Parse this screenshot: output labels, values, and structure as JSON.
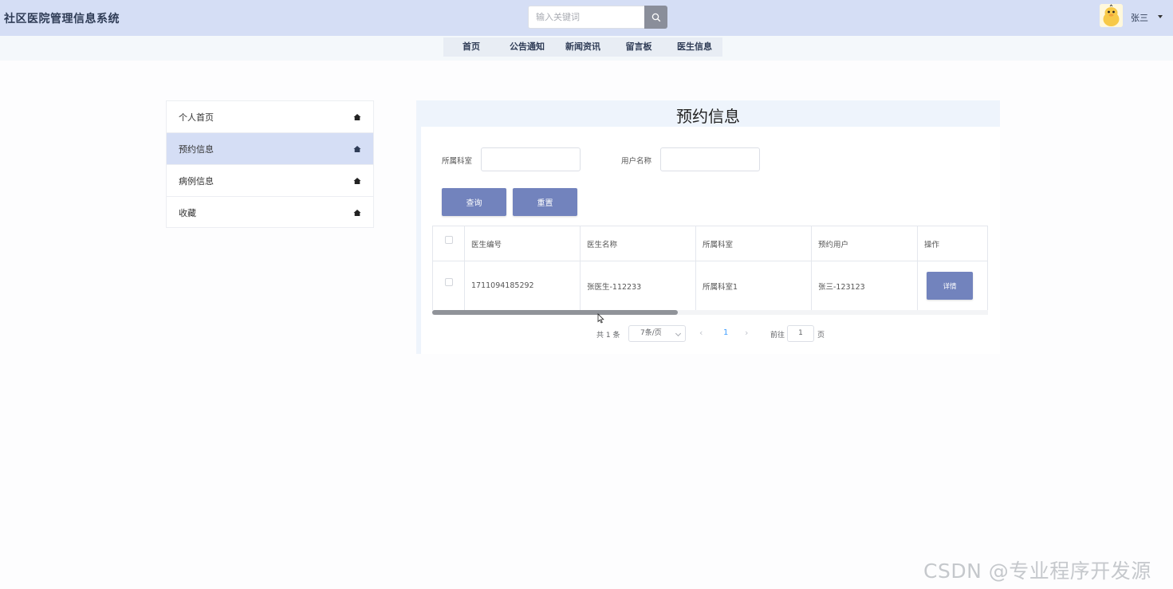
{
  "header": {
    "app_title": "社区医院管理信息系统",
    "search_placeholder": "输入关键词",
    "username": "张三"
  },
  "nav": {
    "items": [
      "首页",
      "公告通知",
      "新闻资讯",
      "留言板",
      "医生信息"
    ]
  },
  "sidebar": {
    "items": [
      {
        "label": "个人首页",
        "icon": "home-icon",
        "active": false
      },
      {
        "label": "预约信息",
        "icon": "home-icon",
        "active": true
      },
      {
        "label": "病例信息",
        "icon": "home-icon",
        "active": false
      },
      {
        "label": "收藏",
        "icon": "home-icon",
        "active": false
      }
    ]
  },
  "main": {
    "title": "预约信息",
    "filters": {
      "department_label": "所属科室",
      "department_value": "",
      "username_label": "用户名称",
      "username_value": ""
    },
    "buttons": {
      "query": "查询",
      "reset": "重置"
    },
    "table": {
      "columns": [
        "医生编号",
        "医生名称",
        "所属科室",
        "预约用户",
        "操作"
      ],
      "rows": [
        {
          "doctor_id": "1711094185292",
          "doctor_name": "张医生-112233",
          "department": "所属科室1",
          "user": "张三-123123",
          "action": "详情"
        }
      ]
    },
    "pagination": {
      "total": "共 1 条",
      "page_size": "7条/页",
      "current_page": "1",
      "goto_label": "前往",
      "goto_value": "1",
      "page_unit": "页"
    }
  },
  "watermark": "CSDN @专业程序开发源",
  "colors": {
    "header_bg": "#d5def5",
    "accent": "#7283bd",
    "active_menu": "#d5def5",
    "link": "#409eff"
  }
}
